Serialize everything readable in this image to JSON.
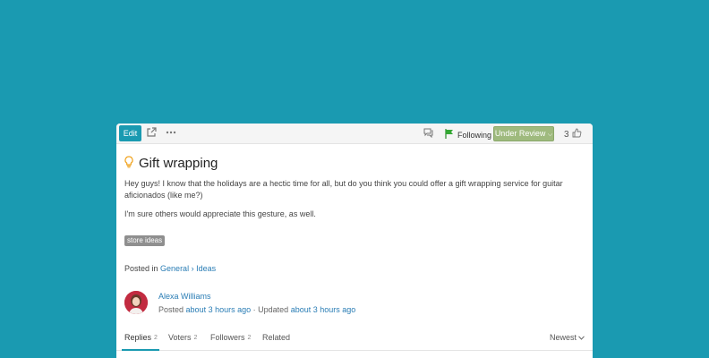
{
  "toolbar": {
    "edit_label": "Edit",
    "following_label": "Following",
    "status_label": "Under Review",
    "vote_count": "3"
  },
  "post": {
    "icon": "lightbulb-icon",
    "title": "Gift wrapping",
    "paragraphs": [
      "Hey guys! I know that the holidays are a hectic time for all, but do you think you could offer a gift wrapping service for guitar aficionados (like me?)",
      "I'm sure others would appreciate this gesture, as well."
    ],
    "tag": "store ideas",
    "posted_in_prefix": "Posted in",
    "category": "General",
    "separator": "›",
    "subcategory": "Ideas"
  },
  "author": {
    "name": "Alexa Williams",
    "posted_label": "Posted",
    "posted_time": "about 3 hours ago",
    "updated_sep": "·",
    "updated_label": "Updated",
    "updated_time": "about 3 hours ago"
  },
  "tabs": [
    {
      "label": "Replies",
      "count": "2"
    },
    {
      "label": "Voters",
      "count": "2"
    },
    {
      "label": "Followers",
      "count": "2"
    },
    {
      "label": "Related",
      "count": ""
    }
  ],
  "sort_label": "Newest",
  "colors": {
    "background": "#1a9ab1",
    "accent": "#1a9ab1",
    "status": "#9fba7e",
    "link": "#2a7db5"
  }
}
